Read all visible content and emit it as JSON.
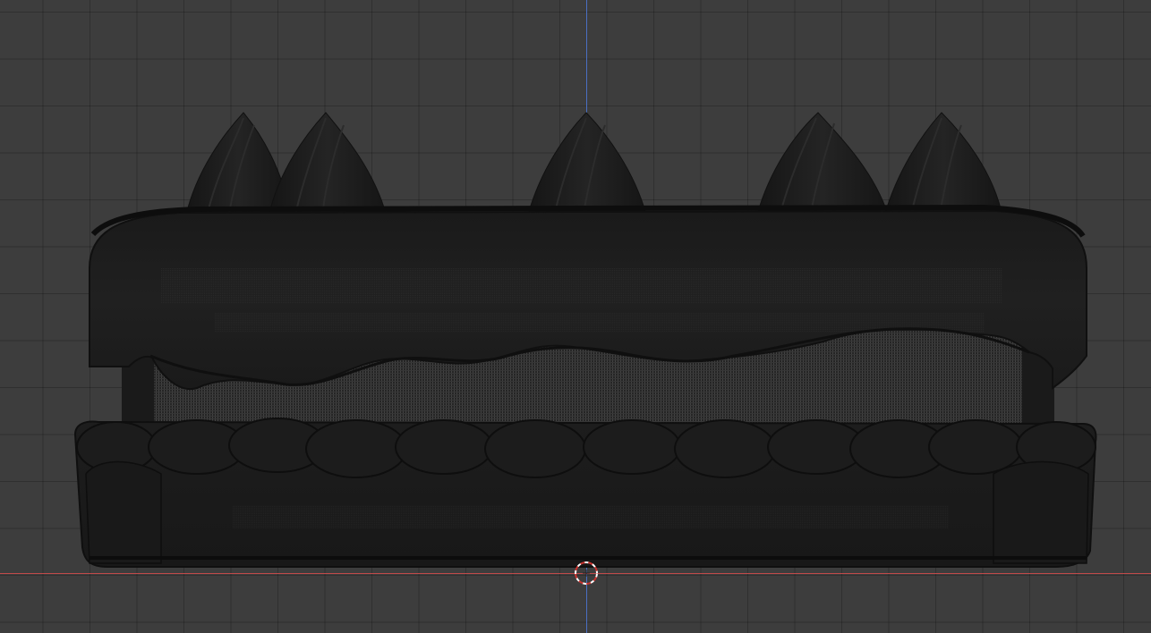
{
  "viewport": {
    "background_color": "#3d3d3d",
    "grid_color": "#333333",
    "x_axis_color": "#c24a4a",
    "z_axis_color": "#4a6fc2",
    "cursor_icon": "3d-cursor-icon"
  },
  "model": {
    "shading": "solid-dark",
    "body_color": "#1c1c1c",
    "shadow_color": "#101010",
    "wire_color": "#5a5a5a"
  }
}
